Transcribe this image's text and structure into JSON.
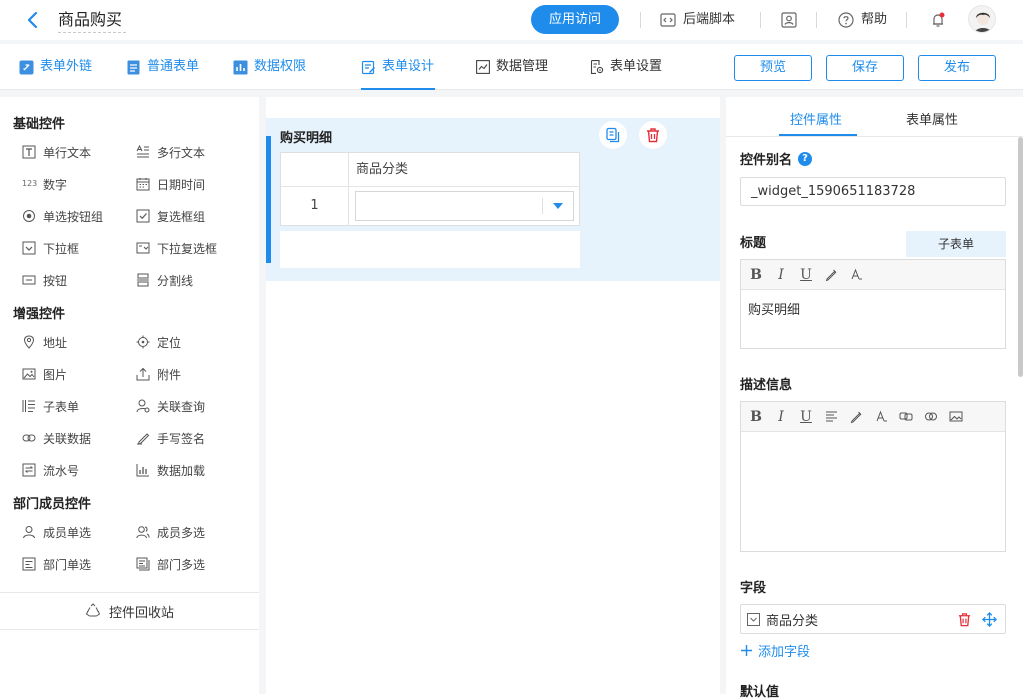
{
  "header": {
    "app_name": "商品购买",
    "visit_label": "应用访问",
    "backend_script_label": "后端脚本",
    "help_label": "帮助"
  },
  "nav": {
    "external_link": "表单外链",
    "normal_form": "普通表单",
    "data_permission": "数据权限",
    "form_design": "表单设计",
    "data_management": "数据管理",
    "form_settings": "表单设置",
    "preview": "预览",
    "save": "保存",
    "publish": "发布"
  },
  "palette": {
    "basic_title": "基础控件",
    "basic": [
      "单行文本",
      "多行文本",
      "数字",
      "日期时间",
      "单选按钮组",
      "复选框组",
      "下拉框",
      "下拉复选框",
      "按钮",
      "分割线"
    ],
    "enhanced_title": "增强控件",
    "enhanced": [
      "地址",
      "定位",
      "图片",
      "附件",
      "子表单",
      "关联查询",
      "关联数据",
      "手写签名",
      "流水号",
      "数据加载"
    ],
    "member_title": "部门成员控件",
    "member": [
      "成员单选",
      "成员多选",
      "部门单选",
      "部门多选"
    ],
    "number_icon_text": "123",
    "recycle_label": "控件回收站"
  },
  "canvas": {
    "block_title": "购买明细",
    "column_header": "商品分类",
    "row_number": "1"
  },
  "props": {
    "tab_widget": "控件属性",
    "tab_form": "表单属性",
    "alias_label": "控件别名",
    "help_icon": "?",
    "alias_value": "_widget_1590651183728",
    "title_label": "标题",
    "subform_tag": "子表单",
    "title_content": "购买明细",
    "desc_label": "描述信息",
    "field_label": "字段",
    "field_name": "商品分类",
    "add_field": "添加字段",
    "default_label": "默认值"
  },
  "colors": {
    "accent": "#1f8ceb",
    "selected_bg": "#e6f2fc",
    "danger": "#e5303b"
  }
}
